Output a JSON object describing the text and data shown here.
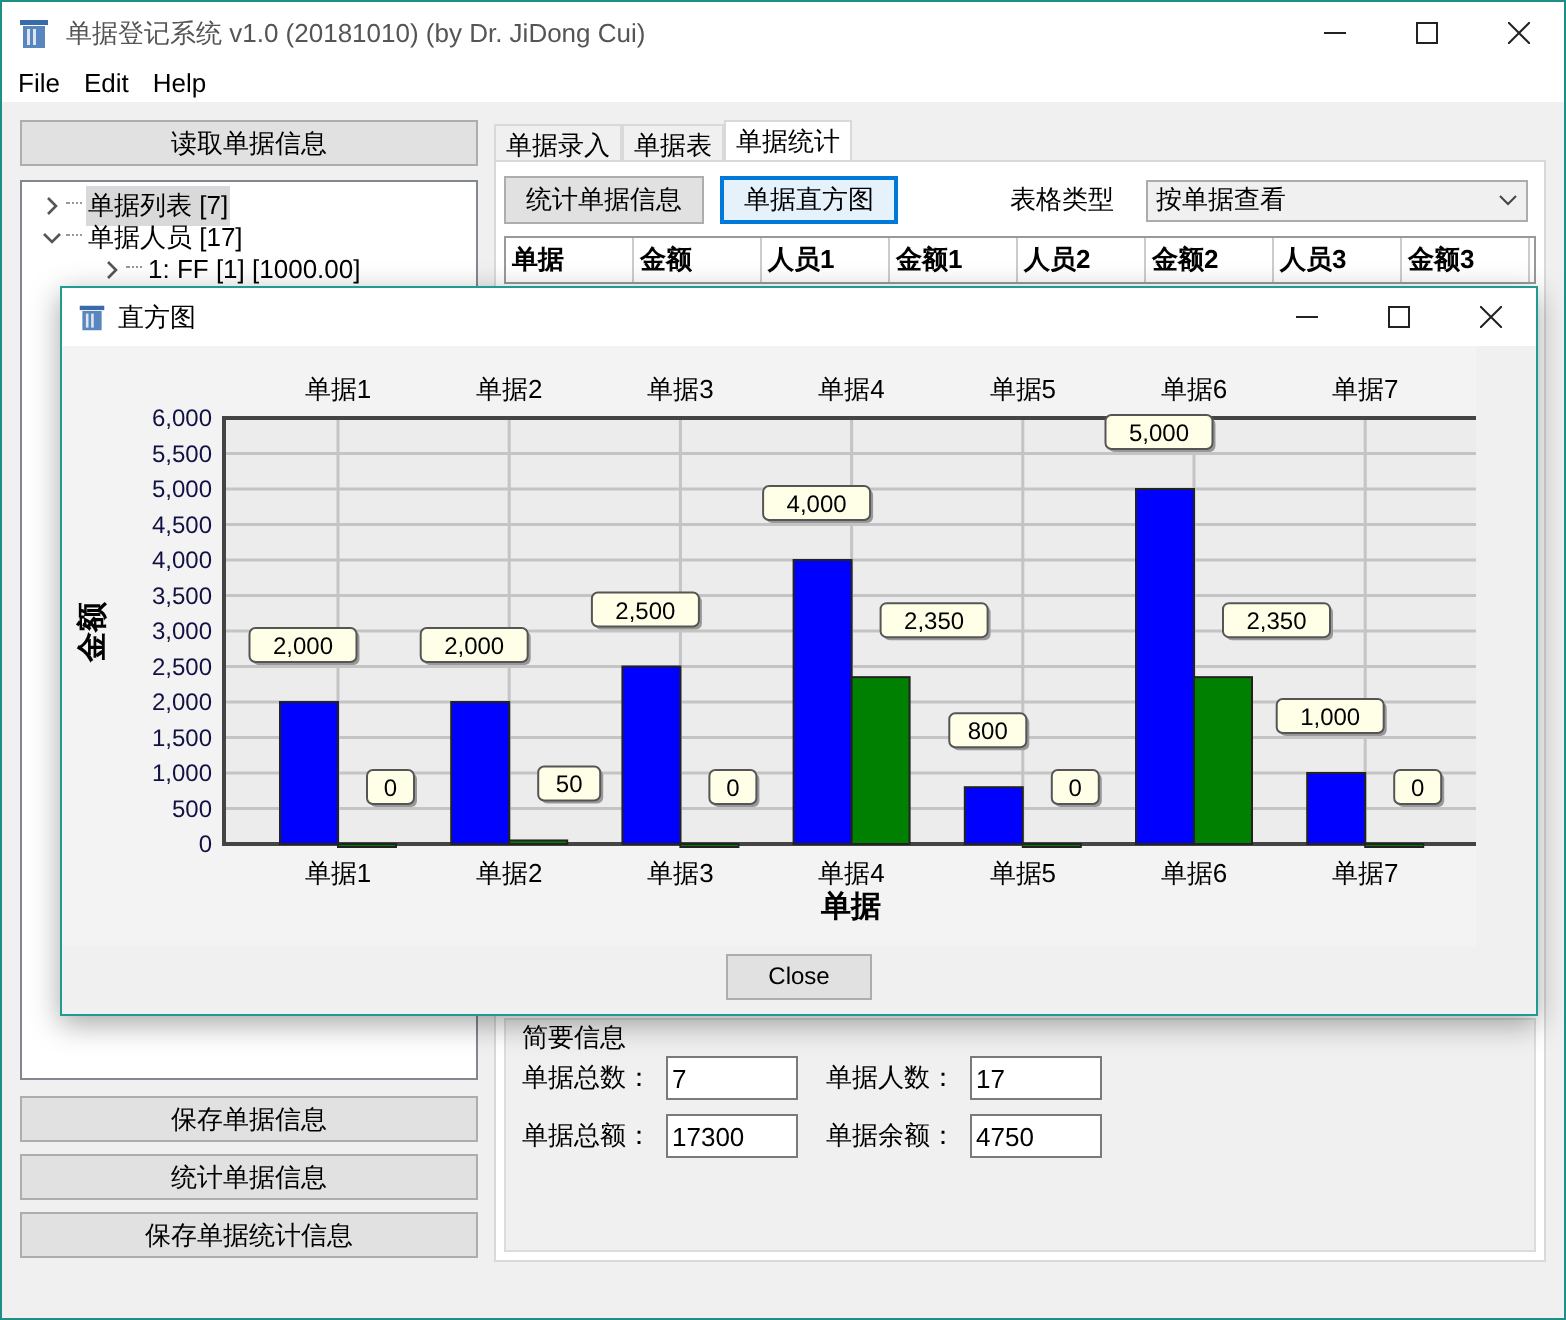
{
  "window": {
    "title": "单据登记系统 v1.0 (20181010) (by Dr. JiDong Cui)"
  },
  "menu": [
    "File",
    "Edit",
    "Help"
  ],
  "left_panel": {
    "read_button": "读取单据信息",
    "tree": [
      {
        "label": "单据列表 [7]",
        "selected": true,
        "expanded": false
      },
      {
        "label": "单据人员 [17]",
        "selected": false,
        "expanded": true,
        "children": [
          {
            "label": "1: FF [1] [1000.00]",
            "selected": false,
            "expanded": false
          }
        ]
      }
    ],
    "buttons": [
      "保存单据信息",
      "统计单据信息",
      "保存单据统计信息"
    ]
  },
  "tabs": [
    {
      "label": "单据录入",
      "selected": false
    },
    {
      "label": "单据表",
      "selected": false
    },
    {
      "label": "单据统计",
      "selected": true
    }
  ],
  "toolbar": {
    "buttons": [
      {
        "label": "统计单据信息",
        "focused": false
      },
      {
        "label": "单据直方图",
        "focused": true
      }
    ],
    "table_type_label": "表格类型",
    "table_type_value": "按单据查看"
  },
  "table": {
    "columns": [
      "单据",
      "金额",
      "人员1",
      "金额1",
      "人员2",
      "金额2",
      "人员3",
      "金额3"
    ]
  },
  "summary": {
    "title": "简要信息",
    "fields": [
      {
        "label": "单据总数：",
        "value": "7"
      },
      {
        "label": "单据人数：",
        "value": "17"
      },
      {
        "label": "单据总额：",
        "value": "17300"
      },
      {
        "label": "单据余额：",
        "value": "4750"
      }
    ]
  },
  "dialog": {
    "title": "直方图",
    "close_button": "Close",
    "top_axis_labels": [
      "单据1",
      "单据2",
      "单据3",
      "单据4",
      "单据5",
      "单据6",
      "单据7"
    ],
    "chart_data": {
      "type": "bar",
      "xlabel": "单据",
      "ylabel": "金额",
      "categories": [
        "单据1",
        "单据2",
        "单据3",
        "单据4",
        "单据5",
        "单据6",
        "单据7"
      ],
      "grid": true,
      "series": [
        {
          "color": "#0000ff",
          "values": [
            2000,
            2000,
            2500,
            4000,
            800,
            5000,
            1000
          ]
        },
        {
          "color": "#008000",
          "values": [
            0,
            50,
            0,
            2350,
            0,
            2350,
            0
          ]
        }
      ],
      "ylim": [
        0,
        6000
      ],
      "yticks": [
        {
          "value": 0,
          "label": "0"
        },
        {
          "value": 500,
          "label": "500"
        },
        {
          "value": 1000,
          "label": "1,000"
        },
        {
          "value": 1500,
          "label": "1,500"
        },
        {
          "value": 2000,
          "label": "2,000"
        },
        {
          "value": 2500,
          "label": "2,500"
        },
        {
          "value": 3000,
          "label": "3,000"
        },
        {
          "value": 3500,
          "label": "3,500"
        },
        {
          "value": 4000,
          "label": "4,000"
        },
        {
          "value": 4500,
          "label": "4,500"
        },
        {
          "value": 5000,
          "label": "5,000"
        },
        {
          "value": 5500,
          "label": "5,500"
        },
        {
          "value": 6000,
          "label": "6,000"
        }
      ],
      "value_labels": [
        [
          "2,000",
          "2,000",
          "2,500",
          "4,000",
          "800",
          "5,000",
          "1,000"
        ],
        [
          "0",
          "50",
          "0",
          "2,350",
          "0",
          "2,350",
          "0"
        ]
      ]
    }
  }
}
